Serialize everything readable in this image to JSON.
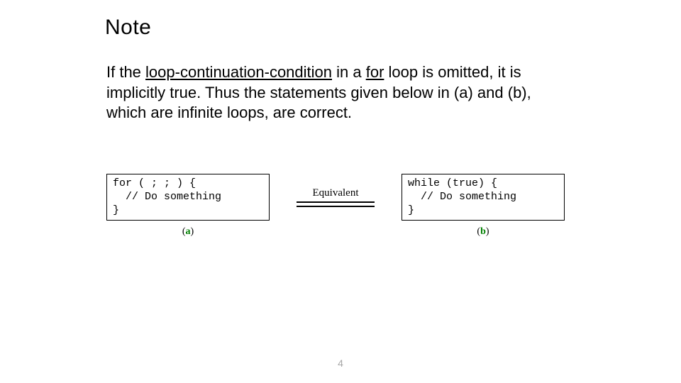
{
  "title": "Note",
  "paragraph": {
    "pre1": "If the ",
    "u1": "loop-continuation-condition",
    "mid1": " in a ",
    "u2": "for",
    "post": " loop is omitted, it is implicitly true. Thus the statements given below in (a) and (b), which are infinite loops, are correct."
  },
  "figure": {
    "code_a": "for ( ; ; ) {\n  // Do something\n}",
    "code_b": "while (true) {\n  // Do something\n}",
    "equivalent_label": "Equivalent",
    "caption_a_paren_open": "(",
    "caption_a_letter": "a",
    "caption_a_paren_close": ")",
    "caption_b_paren_open": "(",
    "caption_b_letter": "b",
    "caption_b_paren_close": ")"
  },
  "page_number": "4"
}
